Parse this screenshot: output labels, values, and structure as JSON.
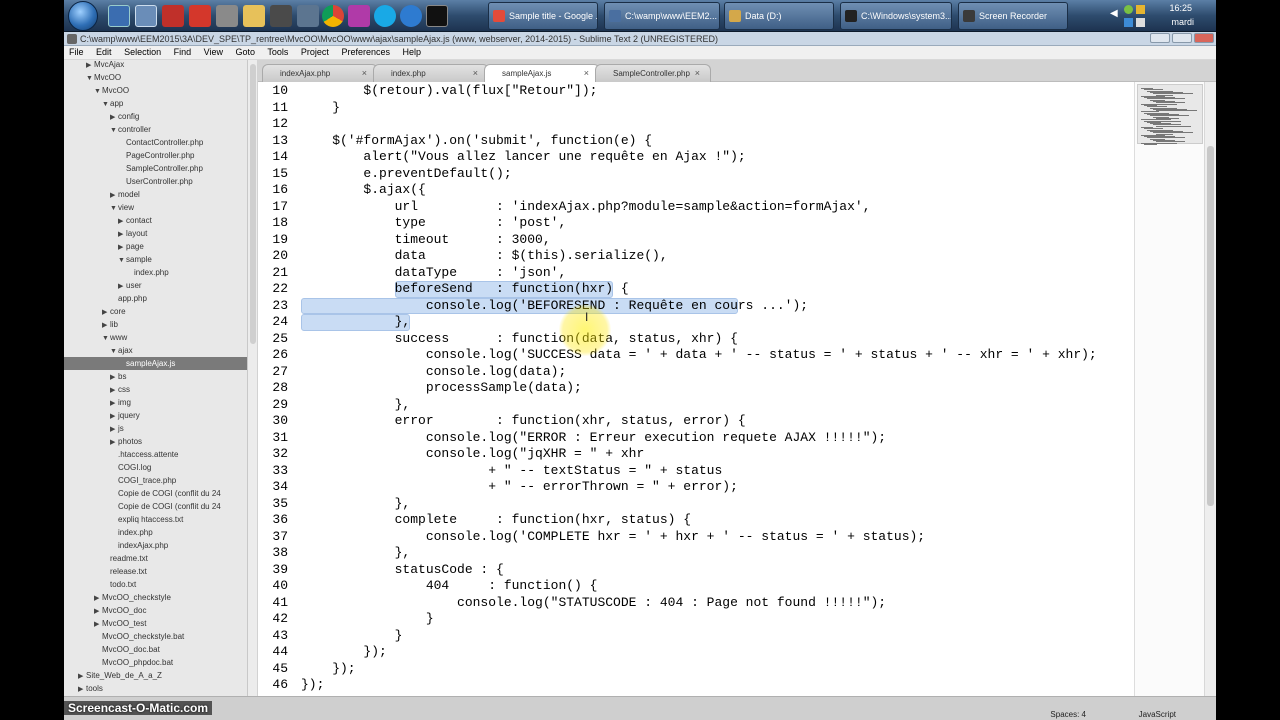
{
  "taskbar": {
    "tasks": [
      {
        "label": "Sample title - Google ...",
        "color": "#e44b3a"
      },
      {
        "label": "C:\\wamp\\www\\EEM2...",
        "color": "#4a6fa0"
      },
      {
        "label": "Data (D:)",
        "color": "#d4a84a"
      },
      {
        "label": "C:\\Windows\\system3...",
        "color": "#222222"
      },
      {
        "label": "Screen Recorder",
        "color": "#3a3a3a"
      }
    ],
    "clock_time": "16:25",
    "clock_day": "mardi"
  },
  "window": {
    "title": "C:\\wamp\\www\\EEM2015\\3A\\DEV_SPE\\TP_rentree\\MvcOO\\MvcOO\\www\\ajax\\sampleAjax.js (www, webserver, 2014-2015) - Sublime Text 2 (UNREGISTERED)",
    "menu": [
      "File",
      "Edit",
      "Selection",
      "Find",
      "View",
      "Goto",
      "Tools",
      "Project",
      "Preferences",
      "Help"
    ]
  },
  "sidebar": [
    {
      "label": "MvcAjax",
      "indent": 1,
      "arrow": "▶"
    },
    {
      "label": "MvcOO",
      "indent": 1,
      "arrow": "▼"
    },
    {
      "label": "MvcOO",
      "indent": 2,
      "arrow": "▼"
    },
    {
      "label": "app",
      "indent": 3,
      "arrow": "▼"
    },
    {
      "label": "config",
      "indent": 4,
      "arrow": "▶"
    },
    {
      "label": "controller",
      "indent": 4,
      "arrow": "▼"
    },
    {
      "label": "ContactController.php",
      "indent": 5,
      "arrow": ""
    },
    {
      "label": "PageController.php",
      "indent": 5,
      "arrow": ""
    },
    {
      "label": "SampleController.php",
      "indent": 5,
      "arrow": ""
    },
    {
      "label": "UserController.php",
      "indent": 5,
      "arrow": ""
    },
    {
      "label": "model",
      "indent": 4,
      "arrow": "▶"
    },
    {
      "label": "view",
      "indent": 4,
      "arrow": "▼"
    },
    {
      "label": "contact",
      "indent": 5,
      "arrow": "▶"
    },
    {
      "label": "layout",
      "indent": 5,
      "arrow": "▶"
    },
    {
      "label": "page",
      "indent": 5,
      "arrow": "▶"
    },
    {
      "label": "sample",
      "indent": 5,
      "arrow": "▼"
    },
    {
      "label": "index.php",
      "indent": 6,
      "arrow": ""
    },
    {
      "label": "user",
      "indent": 5,
      "arrow": "▶"
    },
    {
      "label": "app.php",
      "indent": 4,
      "arrow": ""
    },
    {
      "label": "core",
      "indent": 3,
      "arrow": "▶"
    },
    {
      "label": "lib",
      "indent": 3,
      "arrow": "▶"
    },
    {
      "label": "www",
      "indent": 3,
      "arrow": "▼"
    },
    {
      "label": "ajax",
      "indent": 4,
      "arrow": "▼"
    },
    {
      "label": "sampleAjax.js",
      "indent": 5,
      "arrow": "",
      "selected": true
    },
    {
      "label": "bs",
      "indent": 4,
      "arrow": "▶"
    },
    {
      "label": "css",
      "indent": 4,
      "arrow": "▶"
    },
    {
      "label": "img",
      "indent": 4,
      "arrow": "▶"
    },
    {
      "label": "jquery",
      "indent": 4,
      "arrow": "▶"
    },
    {
      "label": "js",
      "indent": 4,
      "arrow": "▶"
    },
    {
      "label": "photos",
      "indent": 4,
      "arrow": "▶"
    },
    {
      "label": ".htaccess.attente",
      "indent": 4,
      "arrow": ""
    },
    {
      "label": "COGI.log",
      "indent": 4,
      "arrow": ""
    },
    {
      "label": "COGI_trace.php",
      "indent": 4,
      "arrow": ""
    },
    {
      "label": "Copie de COGI (conflit du 24",
      "indent": 4,
      "arrow": ""
    },
    {
      "label": "Copie de COGI (conflit du 24",
      "indent": 4,
      "arrow": ""
    },
    {
      "label": "expliq htaccess.txt",
      "indent": 4,
      "arrow": ""
    },
    {
      "label": "index.php",
      "indent": 4,
      "arrow": ""
    },
    {
      "label": "indexAjax.php",
      "indent": 4,
      "arrow": ""
    },
    {
      "label": "readme.txt",
      "indent": 3,
      "arrow": ""
    },
    {
      "label": "release.txt",
      "indent": 3,
      "arrow": ""
    },
    {
      "label": "todo.txt",
      "indent": 3,
      "arrow": ""
    },
    {
      "label": "MvcOO_checkstyle",
      "indent": 2,
      "arrow": "▶"
    },
    {
      "label": "MvcOO_doc",
      "indent": 2,
      "arrow": "▶"
    },
    {
      "label": "MvcOO_test",
      "indent": 2,
      "arrow": "▶"
    },
    {
      "label": "MvcOO_checkstyle.bat",
      "indent": 2,
      "arrow": ""
    },
    {
      "label": "MvcOO_doc.bat",
      "indent": 2,
      "arrow": ""
    },
    {
      "label": "MvcOO_phpdoc.bat",
      "indent": 2,
      "arrow": ""
    },
    {
      "label": "Site_Web_de_A_a_Z",
      "indent": 0,
      "arrow": "▶"
    },
    {
      "label": "tools",
      "indent": 0,
      "arrow": "▶"
    }
  ],
  "tabs": [
    {
      "label": "indexAjax.php",
      "active": false
    },
    {
      "label": "index.php",
      "active": false
    },
    {
      "label": "sampleAjax.js",
      "active": true
    },
    {
      "label": "SampleController.php",
      "active": false
    }
  ],
  "code": [
    {
      "n": "10",
      "t": "        $(retour).val(flux[\"Retour\"]);"
    },
    {
      "n": "11",
      "t": "    }"
    },
    {
      "n": "12",
      "t": ""
    },
    {
      "n": "13",
      "t": "    $('#formAjax').on('submit', function(e) {"
    },
    {
      "n": "14",
      "t": "        alert(\"Vous allez lancer une requête en Ajax !\");"
    },
    {
      "n": "15",
      "t": "        e.preventDefault();"
    },
    {
      "n": "16",
      "t": "        $.ajax({"
    },
    {
      "n": "17",
      "t": "            url          : 'indexAjax.php?module=sample&action=formAjax',"
    },
    {
      "n": "18",
      "t": "            type         : 'post',"
    },
    {
      "n": "19",
      "t": "            timeout      : 3000,"
    },
    {
      "n": "20",
      "t": "            data         : $(this).serialize(),"
    },
    {
      "n": "21",
      "t": "            dataType     : 'json',"
    },
    {
      "n": "22",
      "t": "            beforeSend   : function(hxr) {"
    },
    {
      "n": "23",
      "t": "                console.log('BEFORESEND : Requête en cours ...');"
    },
    {
      "n": "24",
      "t": "            },"
    },
    {
      "n": "25",
      "t": "            success      : function(data, status, xhr) {"
    },
    {
      "n": "26",
      "t": "                console.log('SUCCESS data = ' + data + ' -- status = ' + status + ' -- xhr = ' + xhr);"
    },
    {
      "n": "27",
      "t": "                console.log(data);"
    },
    {
      "n": "28",
      "t": "                processSample(data);"
    },
    {
      "n": "29",
      "t": "            },"
    },
    {
      "n": "30",
      "t": "            error        : function(xhr, status, error) {"
    },
    {
      "n": "31",
      "t": "                console.log(\"ERROR : Erreur execution requete AJAX !!!!!\");"
    },
    {
      "n": "32",
      "t": "                console.log(\"jqXHR = \" + xhr"
    },
    {
      "n": "33",
      "t": "                        + \" -- textStatus = \" + status"
    },
    {
      "n": "34",
      "t": "                        + \" -- errorThrown = \" + error);"
    },
    {
      "n": "35",
      "t": "            },"
    },
    {
      "n": "36",
      "t": "            complete     : function(hxr, status) {"
    },
    {
      "n": "37",
      "t": "                console.log('COMPLETE hxr = ' + hxr + ' -- status = ' + status);"
    },
    {
      "n": "38",
      "t": "            },"
    },
    {
      "n": "39",
      "t": "            statusCode : {"
    },
    {
      "n": "40",
      "t": "                404     : function() {"
    },
    {
      "n": "41",
      "t": "                    console.log(\"STATUSCODE : 404 : Page not found !!!!!\");"
    },
    {
      "n": "42",
      "t": "                }"
    },
    {
      "n": "43",
      "t": "            }"
    },
    {
      "n": "44",
      "t": "        });"
    },
    {
      "n": "45",
      "t": "    });"
    },
    {
      "n": "46",
      "t": "});"
    }
  ],
  "status": {
    "spaces": "Spaces: 4",
    "syntax": "JavaScript"
  },
  "watermark": "Screencast-O-Matic.com",
  "colors": {
    "selection": "#c9dcf4",
    "sidebar_selected": "#7a7a7a",
    "cursor_highlight": "#ffe600"
  }
}
